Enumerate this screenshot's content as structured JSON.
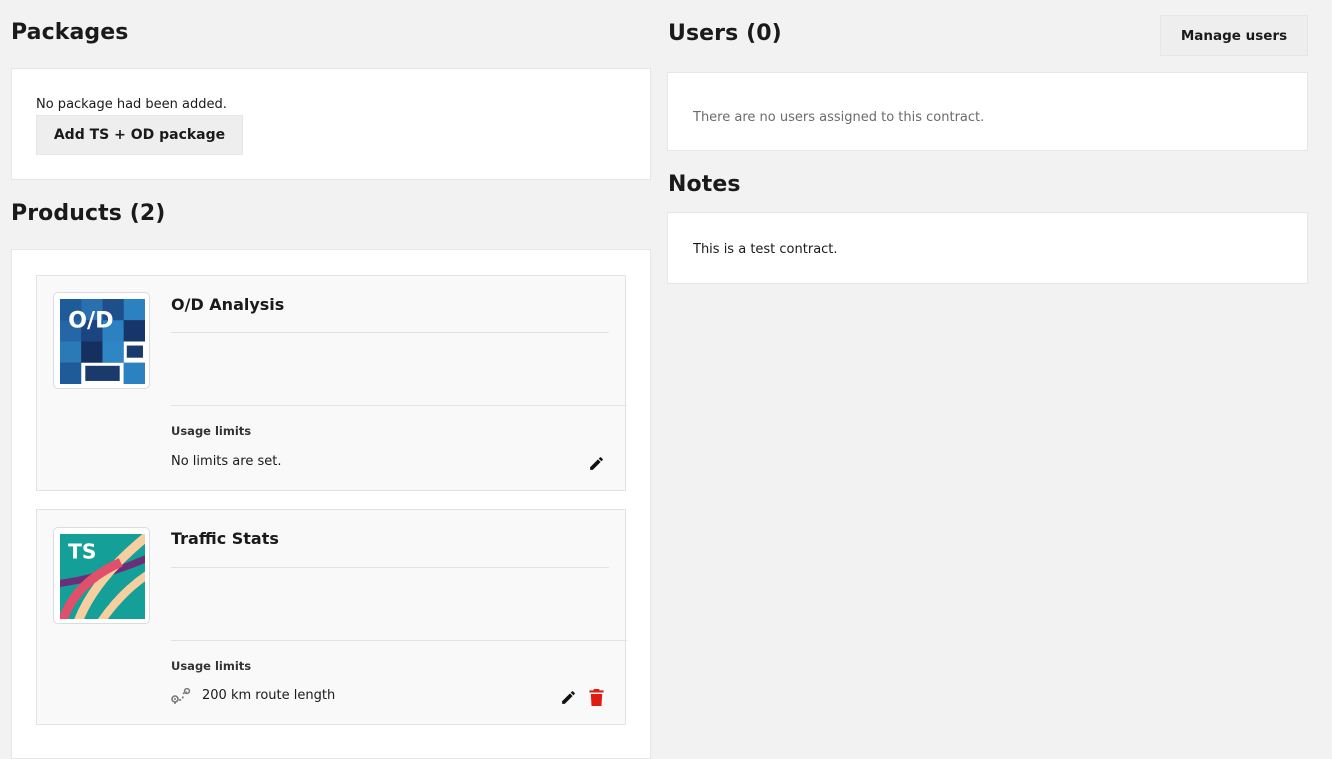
{
  "packages": {
    "title": "Packages",
    "empty_text": "No package had been added.",
    "add_button": "Add TS + OD package"
  },
  "products": {
    "title": "Products (2)",
    "items": [
      {
        "name": "O/D Analysis",
        "logo_text": "O/D",
        "logo_icon": "od-analysis-logo",
        "usage_label": "Usage limits",
        "usage_text": "No limits are set."
      },
      {
        "name": "Traffic Stats",
        "logo_text": "TS",
        "logo_icon": "traffic-stats-logo",
        "usage_label": "Usage limits",
        "usage_text": "200 km route length",
        "usage_icon": "route-icon"
      }
    ]
  },
  "users": {
    "title": "Users (0)",
    "manage_button": "Manage users",
    "empty_text": "There are no users assigned to this contract."
  },
  "notes": {
    "title": "Notes",
    "text": "This is a test contract."
  },
  "colors": {
    "background": "#f2f2f2",
    "panel": "#ffffff",
    "delete": "#df1b12",
    "od_dark": "#1a3a6b",
    "od_light": "#2c82c0",
    "ts_teal": "#14a098"
  }
}
